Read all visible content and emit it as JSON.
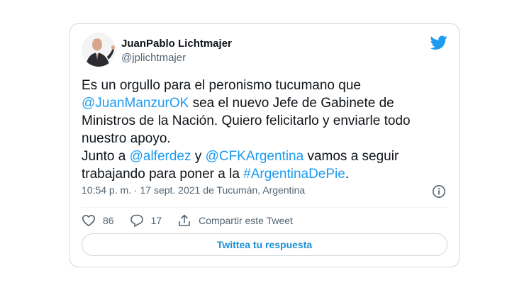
{
  "author": {
    "name": "JuanPablo Lichtmajer",
    "handle": "@jplichtmajer"
  },
  "tweet": {
    "line1": "Es un orgullo para el peronismo tucumano que",
    "mention_manzur": "@JuanManzurOK",
    "line2_rest": " sea el nuevo Jefe de Gabinete de",
    "line3": "Ministros de la Nación. Quiero felicitarlo y enviarle todo",
    "line4": "nuestro apoyo.",
    "line5_start": "Junto a ",
    "mention_alferdez": "@alferdez",
    "line5_mid": " y ",
    "mention_cfk": "@CFKArgentina",
    "line5_end": " vamos a seguir",
    "line6_start": "trabajando para poner a la ",
    "hashtag": "#ArgentinaDePie",
    "line6_end": "."
  },
  "meta": "10:54 p. m. · 17 sept. 2021 de Tucumán, Argentina",
  "actions": {
    "likes": "86",
    "replies": "17",
    "share_label": "Compartir este Tweet"
  },
  "reply_button": "Twittea tu respuesta",
  "colors": {
    "accent": "#1d9bf0",
    "secondary_text": "#536471",
    "border": "#cfd9de"
  },
  "icons": [
    "avatar-photo",
    "twitter-bird-icon",
    "info-icon",
    "heart-icon",
    "reply-bubble-icon",
    "share-icon"
  ]
}
